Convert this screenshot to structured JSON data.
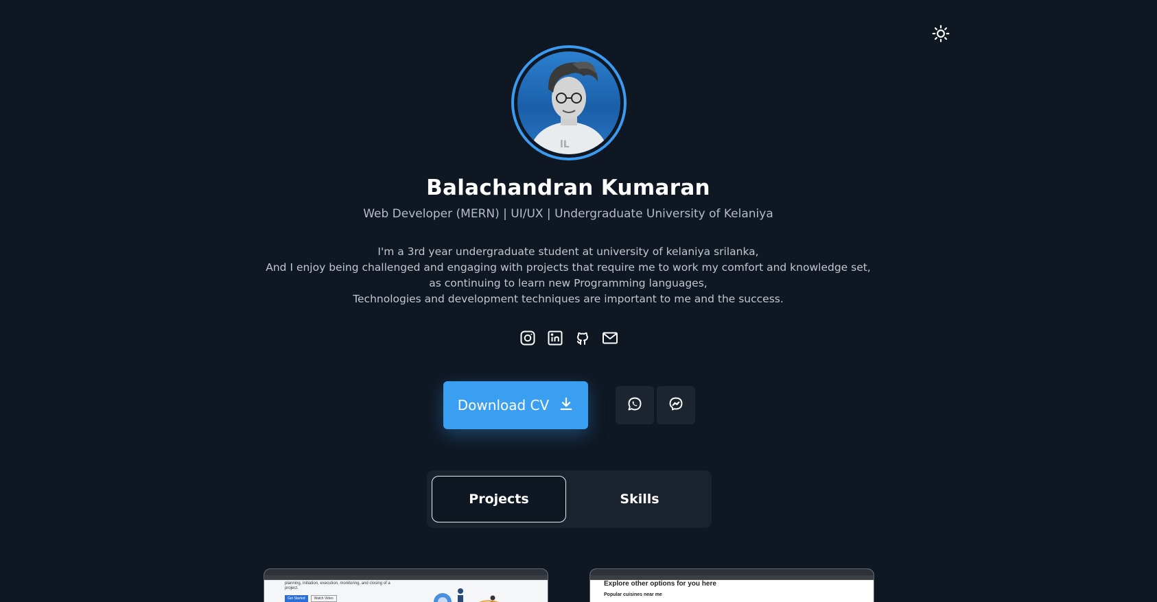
{
  "profile": {
    "name": "Balachandran Kumaran",
    "role": "Web Developer (MERN) | UI/UX | Undergraduate University of Kelaniya",
    "bio": [
      "I'm a 3rd year undergraduate student at university of kelaniya srilanka,",
      "And I enjoy being challenged and engaging with projects that require me to work my comfort and knowledge set,",
      "as continuing to learn new Programming languages,",
      "Technologies and development techniques are important to me and the success."
    ]
  },
  "socials": [
    "instagram-icon",
    "linkedin-icon",
    "github-icon",
    "mail-icon"
  ],
  "actions": {
    "download_label": "Download CV",
    "buttons": [
      "whatsapp-icon",
      "messenger-icon"
    ]
  },
  "tabs": [
    {
      "label": "Projects",
      "active": true
    },
    {
      "label": "Skills",
      "active": false
    }
  ],
  "projects": [
    {
      "text1": "planning, initiation, execution, monitoring, and closing of a project.",
      "btn1": "Get Started",
      "btn2": "Watch Video"
    },
    {
      "text1": "Explore other options for you here",
      "text2": "Popular cuisines near me"
    }
  ],
  "colors": {
    "background": "#0f1723",
    "accent": "#3a9ff0",
    "card": "#1a222d"
  }
}
